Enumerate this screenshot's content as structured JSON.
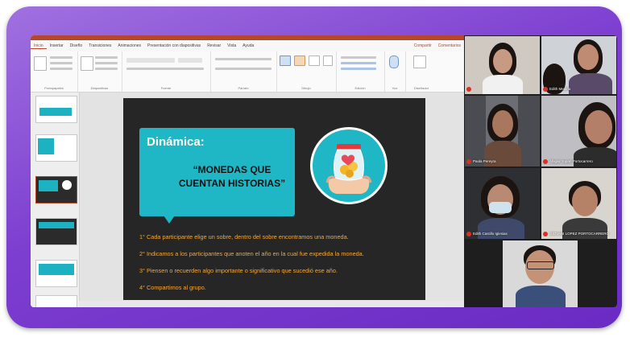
{
  "ribbon": {
    "tabs": [
      "Inicio",
      "Insertar",
      "Diseño",
      "Transiciones",
      "Animaciones",
      "Presentación con diapositivas",
      "Revisar",
      "Vista",
      "Ayuda"
    ],
    "share_label": "Compartir",
    "comments_label": "Comentarios",
    "groups": [
      "Portapapeles",
      "Diapositivas",
      "Fuente",
      "Párrafo",
      "Dibujo",
      "Edición",
      "Voz",
      "Diseñador"
    ]
  },
  "slide": {
    "callout_title": "Dinámica:",
    "callout_body": "“MONEDAS QUE CUENTAN HISTORIAS”",
    "steps": [
      "1° Cada participante elige un sobre, dentro del sobre encontramos una moneda.",
      "2° Indicamos a los participantes que anoten el año en la cual fue expedida la moneda.",
      "3° Piensen o recuerden algo importante o significativo que sucedió ese año.",
      "4° Compartimos al grupo."
    ]
  },
  "participants": [
    {
      "name": ""
    },
    {
      "name": "Edith Medina"
    },
    {
      "name": "Paola Pereyra"
    },
    {
      "name": "Abigail Yupari Portocarrero"
    },
    {
      "name": "Edith Castillo Iglesias"
    },
    {
      "name": "GIOVANI LOPEZ PORTOCARRERO"
    },
    {
      "name": ""
    }
  ],
  "colors": {
    "frame": "#7d3fd0",
    "slide_bg": "#262626",
    "teal": "#1fb6c5",
    "step_text": "#f6a733",
    "ppt_accent": "#b7472a"
  }
}
